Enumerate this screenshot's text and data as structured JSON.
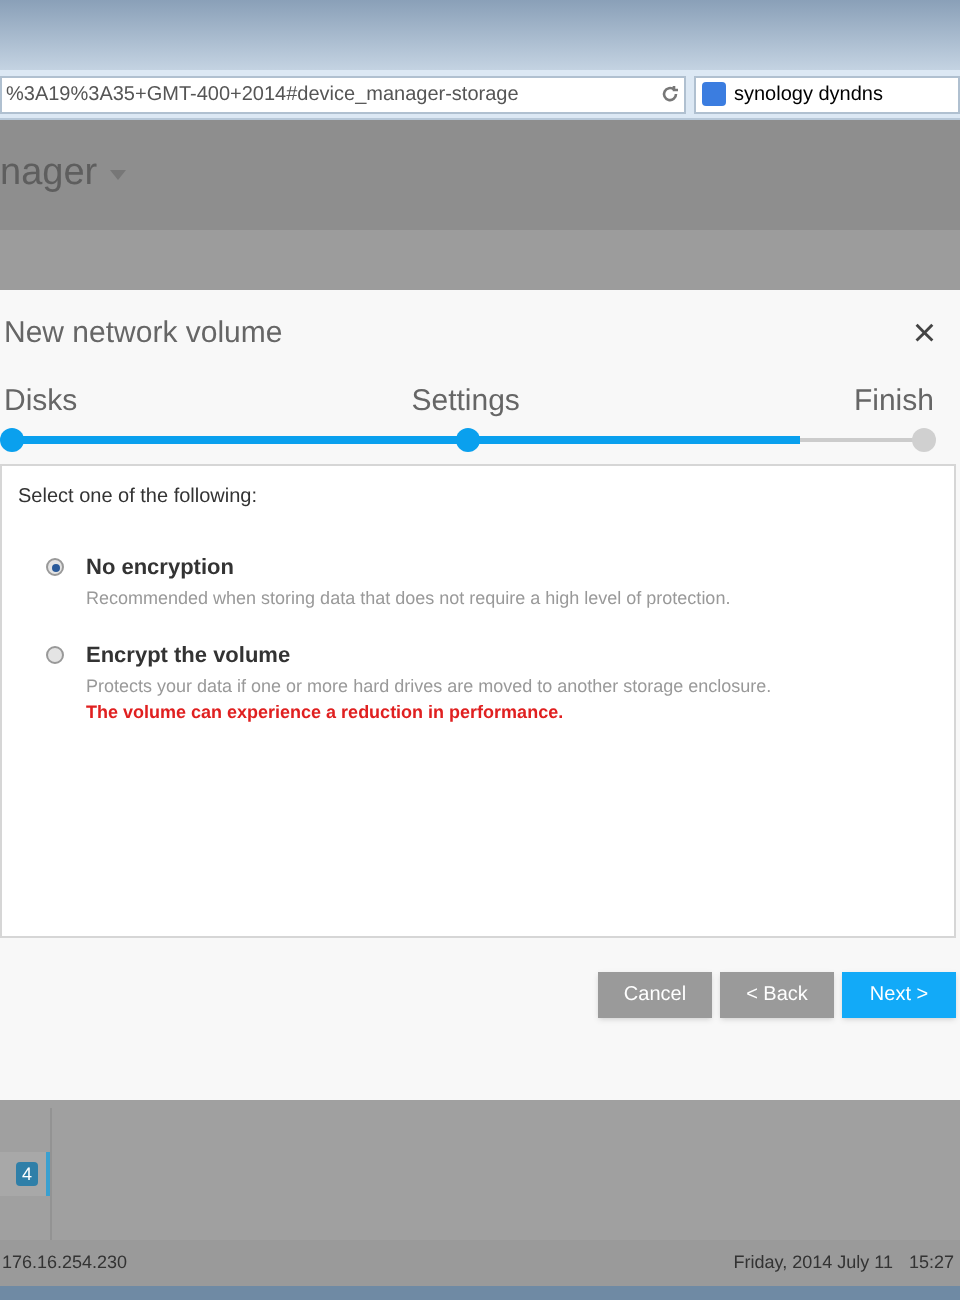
{
  "browser": {
    "address": "%3A19%3A35+GMT-400+2014#device_manager-storage",
    "search": "synology dyndns"
  },
  "app_header": {
    "title": "nager"
  },
  "dialog": {
    "title": "New network volume",
    "close": "×",
    "steps": [
      {
        "label": "Disks",
        "reached": true
      },
      {
        "label": "Settings",
        "reached": true
      },
      {
        "label": "Finish",
        "reached": false
      }
    ],
    "progress": {
      "level": 0.865
    },
    "prompt": "Select one of the following:",
    "options": [
      {
        "label": "No encryption",
        "description": "Recommended when storing data that does not require a high level of protection.",
        "selected": true
      },
      {
        "label": "Encrypt the volume",
        "description": "Protects your data if one or more hard drives are moved to another storage enclosure.",
        "warning": "The volume can experience a reduction in performance.",
        "selected": false
      }
    ],
    "buttons": [
      {
        "label": "Cancel",
        "kind": "secondary"
      },
      {
        "label": "< Back",
        "kind": "secondary"
      },
      {
        "label": "Next >",
        "kind": "primary"
      }
    ]
  },
  "background_badge": "4",
  "status_bar": {
    "ip": "176.16.254.230",
    "date": "Friday, 2014 July 11",
    "time": "15:27"
  }
}
